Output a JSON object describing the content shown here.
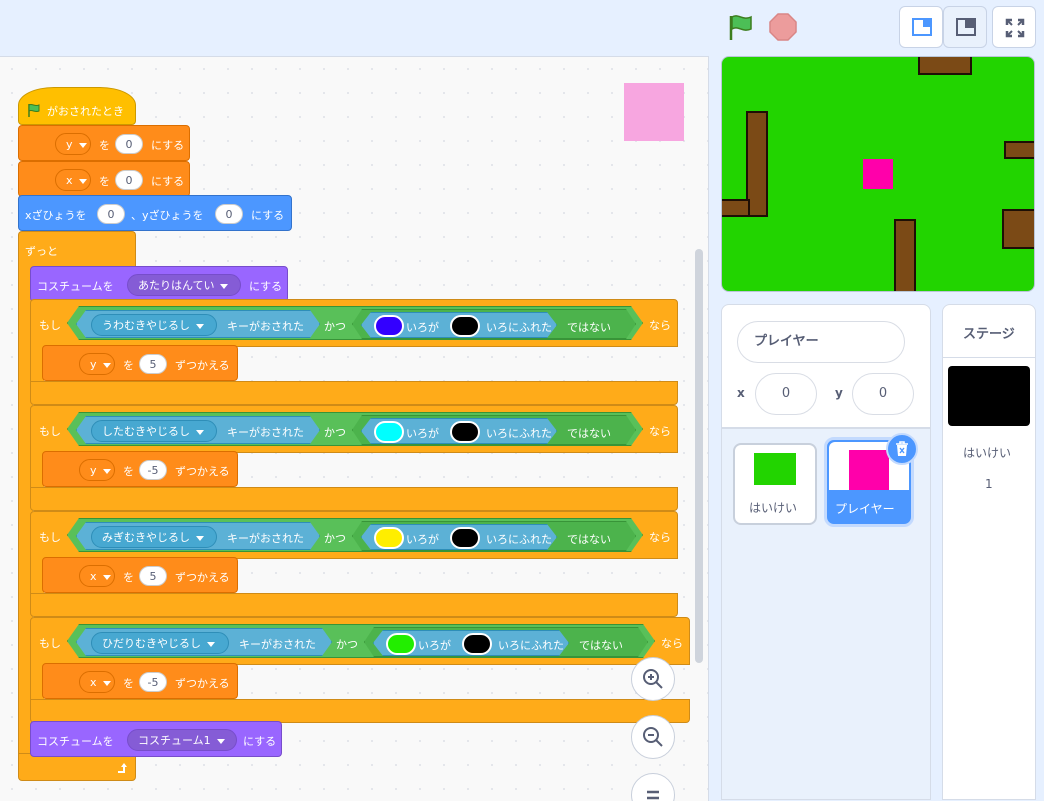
{
  "colors": {
    "event": "#ffbf00",
    "variables": "#ff8c1a",
    "motion": "#4c97ff",
    "control": "#ffab19",
    "looks": "#9966ff",
    "operators": "#59c059",
    "sensing": "#5cb1d6",
    "stage_bg": "#22d400",
    "sprite": "#ff00aa"
  },
  "header": {
    "green_flag_icon": "green-flag-icon",
    "stop_icon": "stop-icon"
  },
  "script": {
    "hat_label": "がおされたとき",
    "set_y": {
      "var": "y",
      "mid": "を",
      "value": "0",
      "end": "にする"
    },
    "set_x": {
      "var": "x",
      "mid": "を",
      "value": "0",
      "end": "にする"
    },
    "goto": {
      "a": "xざひょうを",
      "x": "0",
      "b": "、yざひょうを",
      "y": "0",
      "c": "にする"
    },
    "forever_label": "ずっと",
    "costume1": {
      "a": "コスチュームを",
      "value": "あたりはんてい",
      "c": "にする"
    },
    "ifs": [
      {
        "if": "もし",
        "key": "うわむきやじるし",
        "key_pressed": "キーがおされた",
        "and": "かつ",
        "color": "#3300ff",
        "touch_a": "いろが",
        "touch_b": "いろにふれた",
        "not": "ではない",
        "then": "なら",
        "var": "y",
        "change_a": "を",
        "delta": "5",
        "change_b": "ずつかえる"
      },
      {
        "if": "もし",
        "key": "したむきやじるし",
        "key_pressed": "キーがおされた",
        "and": "かつ",
        "color": "#00ffff",
        "touch_a": "いろが",
        "touch_b": "いろにふれた",
        "not": "ではない",
        "then": "なら",
        "var": "y",
        "change_a": "を",
        "delta": "-5",
        "change_b": "ずつかえる"
      },
      {
        "if": "もし",
        "key": "みぎむきやじるし",
        "key_pressed": "キーがおされた",
        "and": "かつ",
        "color": "#ffee00",
        "touch_a": "いろが",
        "touch_b": "いろにふれた",
        "not": "ではない",
        "then": "なら",
        "var": "x",
        "change_a": "を",
        "delta": "5",
        "change_b": "ずつかえる"
      },
      {
        "if": "もし",
        "key": "ひだりむきやじるし",
        "key_pressed": "キーがおされた",
        "and": "かつ",
        "color": "#22ee00",
        "touch_a": "いろが",
        "touch_b": "いろにふれた",
        "not": "ではない",
        "then": "なら",
        "var": "x",
        "change_a": "を",
        "delta": "-5",
        "change_b": "ずつかえる"
      }
    ],
    "costume2": {
      "a": "コスチュームを",
      "value": "コスチューム1",
      "c": "にする"
    }
  },
  "sprite_info": {
    "name": "プレイヤー",
    "x_label": "x",
    "x_value": "0",
    "y_label": "y",
    "y_value": "0"
  },
  "sprites": [
    {
      "name": "はいけい"
    },
    {
      "name": "プレイヤー"
    }
  ],
  "stage_panel": {
    "title": "ステージ",
    "backdrop_name": "はいけい",
    "backdrop_count": "1"
  }
}
